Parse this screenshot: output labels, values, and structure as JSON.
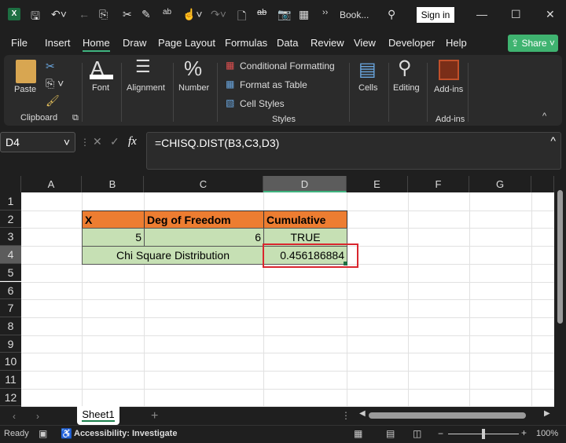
{
  "titlebar": {
    "app_icon": "excel-icon",
    "title": "Book...",
    "sign_in": "Sign in",
    "icons": [
      "save-icon",
      "undo-icon",
      "back-icon",
      "paste-icon",
      "cut-icon",
      "signature-icon",
      "spelling-icon",
      "touch-icon",
      "redo-icon",
      "new-file-icon",
      "strikethrough-icon",
      "camera-icon",
      "form-icon",
      "more-icon",
      "search-icon"
    ]
  },
  "menu": {
    "tabs": [
      "File",
      "Insert",
      "Home",
      "Draw",
      "Page Layout",
      "Formulas",
      "Data",
      "Review",
      "View",
      "Developer",
      "Help"
    ],
    "active": "Home",
    "share": "Share"
  },
  "ribbon": {
    "clipboard": {
      "paste": "Paste",
      "label": "Clipboard"
    },
    "font": "Font",
    "alignment": "Alignment",
    "number": "Number",
    "styles": {
      "conditional": "Conditional Formatting",
      "format_table": "Format as Table",
      "cell_styles": "Cell Styles",
      "label": "Styles"
    },
    "cells": "Cells",
    "editing": "Editing",
    "addins": {
      "button": "Add-ins",
      "label": "Add-ins"
    }
  },
  "formula_bar": {
    "name_box": "D4",
    "fx": "fx",
    "formula": "=CHISQ.DIST(B3,C3,D3)"
  },
  "sheet": {
    "columns": [
      "A",
      "B",
      "C",
      "D",
      "E",
      "F",
      "G"
    ],
    "rows": [
      "1",
      "2",
      "3",
      "4",
      "5",
      "6",
      "7",
      "8",
      "9",
      "10",
      "11",
      "12"
    ],
    "selected_cell": "D4",
    "cells": {
      "B2": "X",
      "C2": "Deg of Freedom",
      "D2": "Cumulative",
      "B3": "5",
      "C3": "6",
      "D3": "TRUE",
      "B4": "Chi Square Distribution",
      "D4": "0.456186884"
    },
    "colors": {
      "header_fill": "#ed7d31",
      "data_fill": "#c6e0b4",
      "highlight_border": "#d9262e"
    }
  },
  "tabs": {
    "sheets": [
      "Sheet1"
    ],
    "active": "Sheet1",
    "add": "+"
  },
  "status": {
    "ready": "Ready",
    "accessibility": "Accessibility: Investigate",
    "zoom": "100%",
    "zoom_level": 100
  }
}
